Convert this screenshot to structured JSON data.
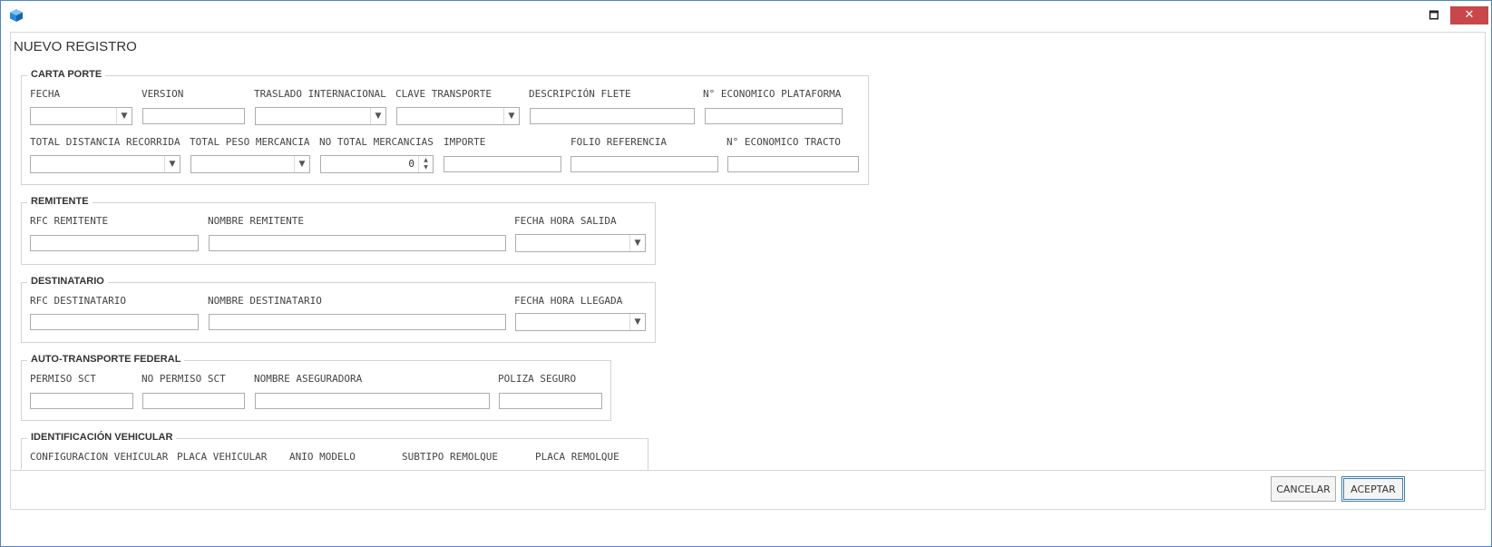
{
  "window": {
    "maximize_glyph": "🗖",
    "close_glyph": "✕",
    "accent": "#4a86c8",
    "close_bg": "#c9464a"
  },
  "form": {
    "title": "NUEVO REGISTRO"
  },
  "carta_porte": {
    "legend": "CARTA PORTE",
    "fecha": "FECHA",
    "version": "VERSION",
    "traslado": "TRASLADO INTERNACIONAL",
    "clave_transporte": "CLAVE TRANSPORTE",
    "descripcion_flete": "DESCRIPCIÓN FLETE",
    "no_eco_plataforma": "N° ECONOMICO PLATAFORMA",
    "total_distancia": "TOTAL DISTANCIA RECORRIDA",
    "total_peso": "TOTAL PESO MERCANCIA",
    "no_total_mercancias": "NO TOTAL MERCANCIAS",
    "no_total_mercancias_value": "0",
    "importe": "IMPORTE",
    "folio_referencia": "FOLIO REFERENCIA",
    "no_eco_tracto": "N° ECONOMICO TRACTO"
  },
  "remitente": {
    "legend": "REMITENTE",
    "rfc": "RFC REMITENTE",
    "nombre": "NOMBRE REMITENTE",
    "fecha_hora": "FECHA HORA SALIDA"
  },
  "destinatario": {
    "legend": "DESTINATARIO",
    "rfc": "RFC DESTINATARIO",
    "nombre": "NOMBRE DESTINATARIO",
    "fecha_hora": "FECHA HORA LLEGADA"
  },
  "autotransporte": {
    "legend": "AUTO-TRANSPORTE FEDERAL",
    "permiso_sct": "PERMISO SCT",
    "no_permiso_sct": "NO PERMISO SCT",
    "nombre_aseguradora": "NOMBRE ASEGURADORA",
    "poliza_seguro": "POLIZA SEGURO"
  },
  "identificacion": {
    "legend": "IDENTIFICACIÓN VEHICULAR",
    "config_vehicular": "CONFIGURACION VEHICULAR",
    "placa_vehicular": "PLACA VEHICULAR",
    "anio_modelo": "ANIO MODELO",
    "subtipo_remolque": "SUBTIPO REMOLQUE",
    "placa_remolque": "PLACA REMOLQUE"
  },
  "footer": {
    "cancel_label": "CANCELAR",
    "accept_label": "ACEPTAR"
  }
}
